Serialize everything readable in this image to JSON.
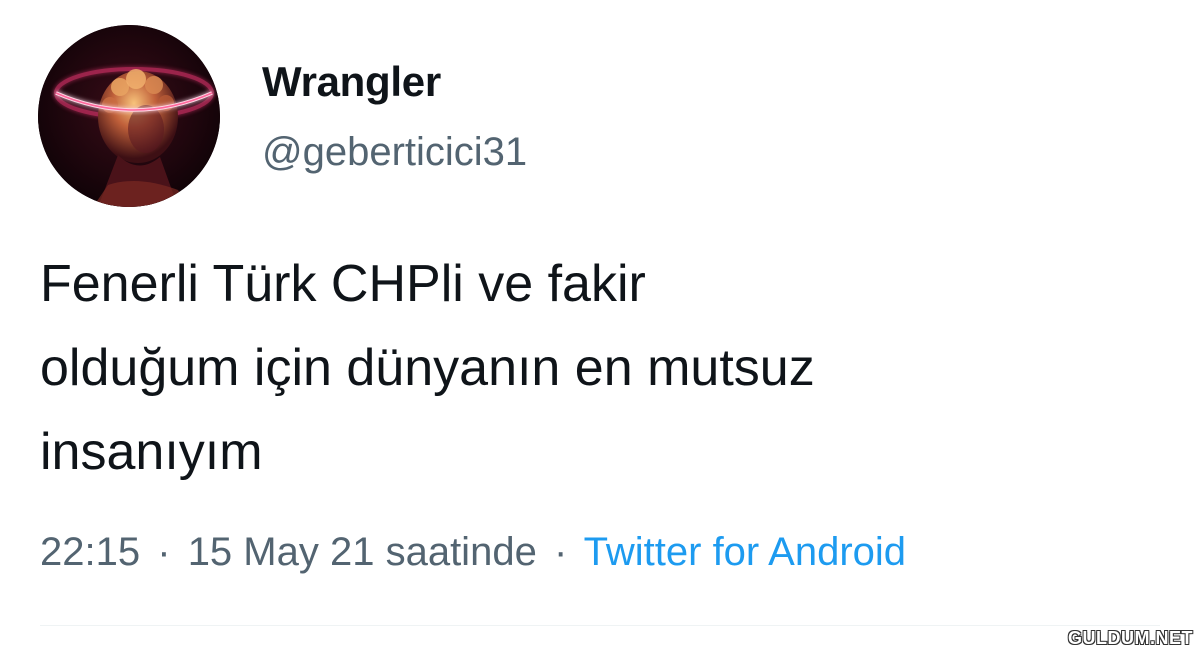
{
  "tweet": {
    "display_name": "Wrangler",
    "handle": "@geberticici31",
    "text_lines": [
      "Fenerli Türk CHPli ve fakir",
      "olduğum için dünyanın en mutsuz",
      "insanıyım"
    ],
    "time": "22:15",
    "date": "15 May 21 saatinde",
    "separator": "·",
    "source": "Twitter for Android"
  },
  "watermark": "GULDUM.NET",
  "colors": {
    "text": "#0f1419",
    "secondary": "#536471",
    "link": "#1d9bf0",
    "avatar_bg": "#120409",
    "halo": "#ff4f8a"
  },
  "icons": {
    "avatar": "avatar-halo-statue-image"
  }
}
